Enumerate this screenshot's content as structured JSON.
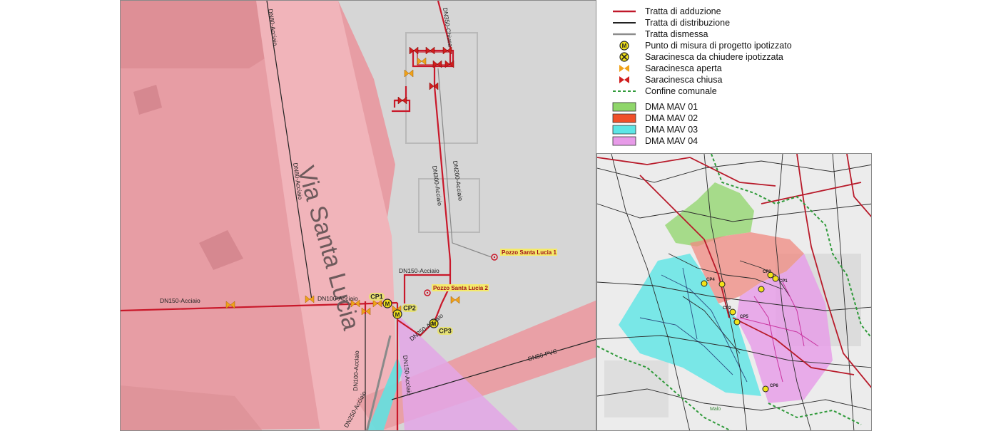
{
  "main_map": {
    "street_label": "Via Santa Lucia",
    "pipe_labels": [
      "DN350-Chiusa",
      "DN80-Acciaio",
      "DN80-Acciaio",
      "DN200-Acciaio",
      "DN300-Acciaio",
      "DN150-Acciaio",
      "DN150-Acciaio",
      "DN100-Acciaio",
      "DN250-Acciaio",
      "DN100-Acciaio",
      "DN150-Acciaio",
      "DN250-Acciaio",
      "DN50-PVC"
    ],
    "wells": [
      "Pozzo Santa Lucia 1",
      "Pozzo Santa Lucia 2"
    ],
    "measure_points": [
      "CP1",
      "CP2",
      "CP3"
    ]
  },
  "legend": {
    "items": [
      {
        "label": "Tratta di adduzione",
        "symbol": "line-red",
        "color": "#c0182a"
      },
      {
        "label": "Tratta di distribuzione",
        "symbol": "line-black",
        "color": "#222222"
      },
      {
        "label": "Tratta dismessa",
        "symbol": "line-grey",
        "color": "#8c8c8c"
      },
      {
        "label": "Punto di misura di progetto ipotizzato",
        "symbol": "measure-point-icon",
        "color": "#f2e21a"
      },
      {
        "label": "Saracinesca da chiudere ipotizzata",
        "symbol": "valve-cross-icon",
        "color": "#f2e21a"
      },
      {
        "label": "Saracinesca aperta",
        "symbol": "valve-open-icon",
        "color": "#f0a21a"
      },
      {
        "label": "Saracinesca chiusa",
        "symbol": "valve-closed-icon",
        "color": "#d01e1e"
      },
      {
        "label": "Confine comunale",
        "symbol": "line-green-dashed",
        "color": "#2f9a3a"
      },
      {
        "label": "DMA MAV 01",
        "symbol": "fill",
        "color": "#8fd66a"
      },
      {
        "label": "DMA MAV 02",
        "symbol": "fill",
        "color": "#f0502a"
      },
      {
        "label": "DMA MAV 03",
        "symbol": "fill",
        "color": "#5ce6e6"
      },
      {
        "label": "DMA MAV 04",
        "symbol": "fill",
        "color": "#e79be8"
      }
    ]
  },
  "inset_map": {
    "labels": [
      "Malo",
      "CP1",
      "CP2",
      "CP3",
      "CP4",
      "CP5",
      "CP6"
    ]
  }
}
